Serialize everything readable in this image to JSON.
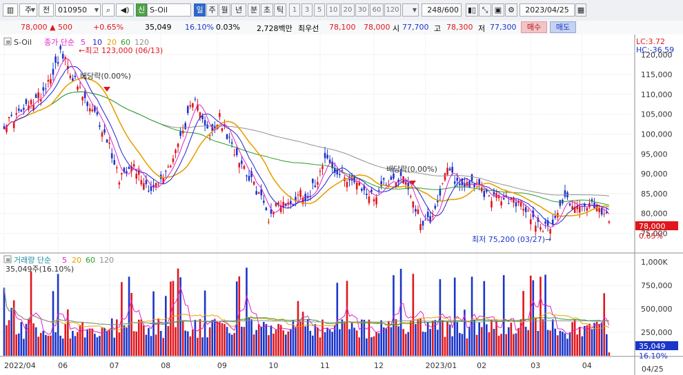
{
  "toolbar": {
    "market": "주",
    "prev": "전",
    "code": "010950",
    "name_tag": "신",
    "name": "S-Oil",
    "periods": [
      "일",
      "주",
      "월",
      "년",
      "분",
      "초",
      "틱"
    ],
    "active_period": "일",
    "intervals": [
      "1",
      "3",
      "5",
      "10",
      "20",
      "30",
      "60",
      "120"
    ],
    "count": "248/600",
    "date": "2023/04/25"
  },
  "quote": {
    "price": "78,000",
    "change": "▲ 500",
    "change_pct": "+0.65%",
    "volume": "35,049",
    "vol_ratio": "16.10%",
    "turnover": "0.03%",
    "amount": "2,728백만",
    "pref": "최우선",
    "ask": "78,100",
    "bid": "78,000",
    "open_label": "시",
    "open": "77,700",
    "high_label": "고",
    "high": "78,300",
    "low_label": "저",
    "low": "77,300",
    "buy": "매수",
    "sell": "매도"
  },
  "colors": {
    "up": "#e0161c",
    "down": "#1b35c9",
    "ma5": "#e020c8",
    "ma10": "#2020d0",
    "ma20": "#e8a000",
    "ma60": "#2a9a2a",
    "ma120": "#909090"
  },
  "price_panel": {
    "title": "S-Oil",
    "legend_prefix": "종가 단순",
    "legend_items": [
      "5",
      "10",
      "20",
      "60",
      "120"
    ],
    "lc": "LC:3.72",
    "hc": "HC:-36.59",
    "max_note": "←최고 123,000 (06/13)",
    "min_note": "최저 75,200 (03/27)→",
    "div_note1": "배당락(0.00%)",
    "div_note2": "배당락(0.00%)",
    "cur_price": "78,000",
    "cur_pct": "0.65%"
  },
  "volume_panel": {
    "legend_prefix": "거래량 단순",
    "legend_items": [
      "5",
      "20",
      "60",
      "120"
    ],
    "label": "35,049주(16.10%)",
    "cur_vol": "35,049",
    "cur_pct": "16.10%"
  },
  "chart_data": {
    "type": "candlestick",
    "price_axis": {
      "min": 73000,
      "max": 123000,
      "ticks": [
        75000,
        80000,
        85000,
        90000,
        95000,
        100000,
        105000,
        110000,
        115000,
        120000
      ],
      "tick_labels": [
        "75,000",
        "80,000",
        "85,000",
        "90,000",
        "95,000",
        "100,000",
        "105,000",
        "110,000",
        "115,000",
        "120,000"
      ]
    },
    "volume_axis": {
      "min": 0,
      "max": 1000000,
      "ticks": [
        250000,
        500000,
        750000,
        1000000
      ],
      "tick_labels": [
        "250,000",
        "500,000",
        "750,000",
        "1,000K"
      ]
    },
    "x_labels": [
      "2022/04",
      "06",
      "07",
      "08",
      "09",
      "10",
      "11",
      "12",
      "2023/01",
      "02",
      "03",
      "04"
    ],
    "x_label_index": [
      0,
      22,
      43,
      64,
      87,
      108,
      129,
      151,
      172,
      193,
      215,
      236
    ],
    "end_label": "04/25",
    "close_anchors": [
      [
        0,
        102500
      ],
      [
        8,
        106000
      ],
      [
        15,
        110000
      ],
      [
        20,
        116000
      ],
      [
        23,
        120500
      ],
      [
        26,
        117000
      ],
      [
        30,
        112000
      ],
      [
        34,
        107000
      ],
      [
        38,
        104000
      ],
      [
        43,
        97000
      ],
      [
        47,
        89000
      ],
      [
        52,
        93000
      ],
      [
        56,
        89000
      ],
      [
        60,
        86000
      ],
      [
        64,
        88000
      ],
      [
        68,
        93000
      ],
      [
        72,
        99000
      ],
      [
        76,
        106000
      ],
      [
        79,
        108500
      ],
      [
        84,
        99000
      ],
      [
        88,
        104000
      ],
      [
        92,
        98000
      ],
      [
        97,
        93000
      ],
      [
        101,
        88000
      ],
      [
        105,
        84000
      ],
      [
        108,
        79000
      ],
      [
        112,
        83000
      ],
      [
        117,
        82000
      ],
      [
        121,
        85500
      ],
      [
        124,
        84000
      ],
      [
        128,
        89000
      ],
      [
        131,
        95000
      ],
      [
        135,
        90000
      ],
      [
        141,
        89000
      ],
      [
        146,
        86000
      ],
      [
        151,
        84000
      ],
      [
        155,
        88000
      ],
      [
        160,
        88500
      ],
      [
        163,
        89500
      ],
      [
        166,
        85000
      ],
      [
        170,
        78000
      ],
      [
        174,
        78500
      ],
      [
        178,
        85000
      ],
      [
        181,
        91000
      ],
      [
        186,
        87000
      ],
      [
        191,
        88000
      ],
      [
        196,
        85000
      ],
      [
        201,
        84000
      ],
      [
        205,
        83500
      ],
      [
        209,
        83000
      ],
      [
        214,
        80000
      ],
      [
        219,
        77000
      ],
      [
        222,
        76000
      ],
      [
        226,
        80500
      ],
      [
        229,
        84000
      ],
      [
        232,
        82500
      ],
      [
        235,
        81000
      ],
      [
        239,
        82000
      ],
      [
        244,
        80500
      ],
      [
        247,
        78000
      ]
    ],
    "high": 123000,
    "high_date": "06/13",
    "low": 75200,
    "low_date": "03/27",
    "last": {
      "open": 77700,
      "high": 78300,
      "low": 77300,
      "close": 78000,
      "volume": 35049
    }
  }
}
